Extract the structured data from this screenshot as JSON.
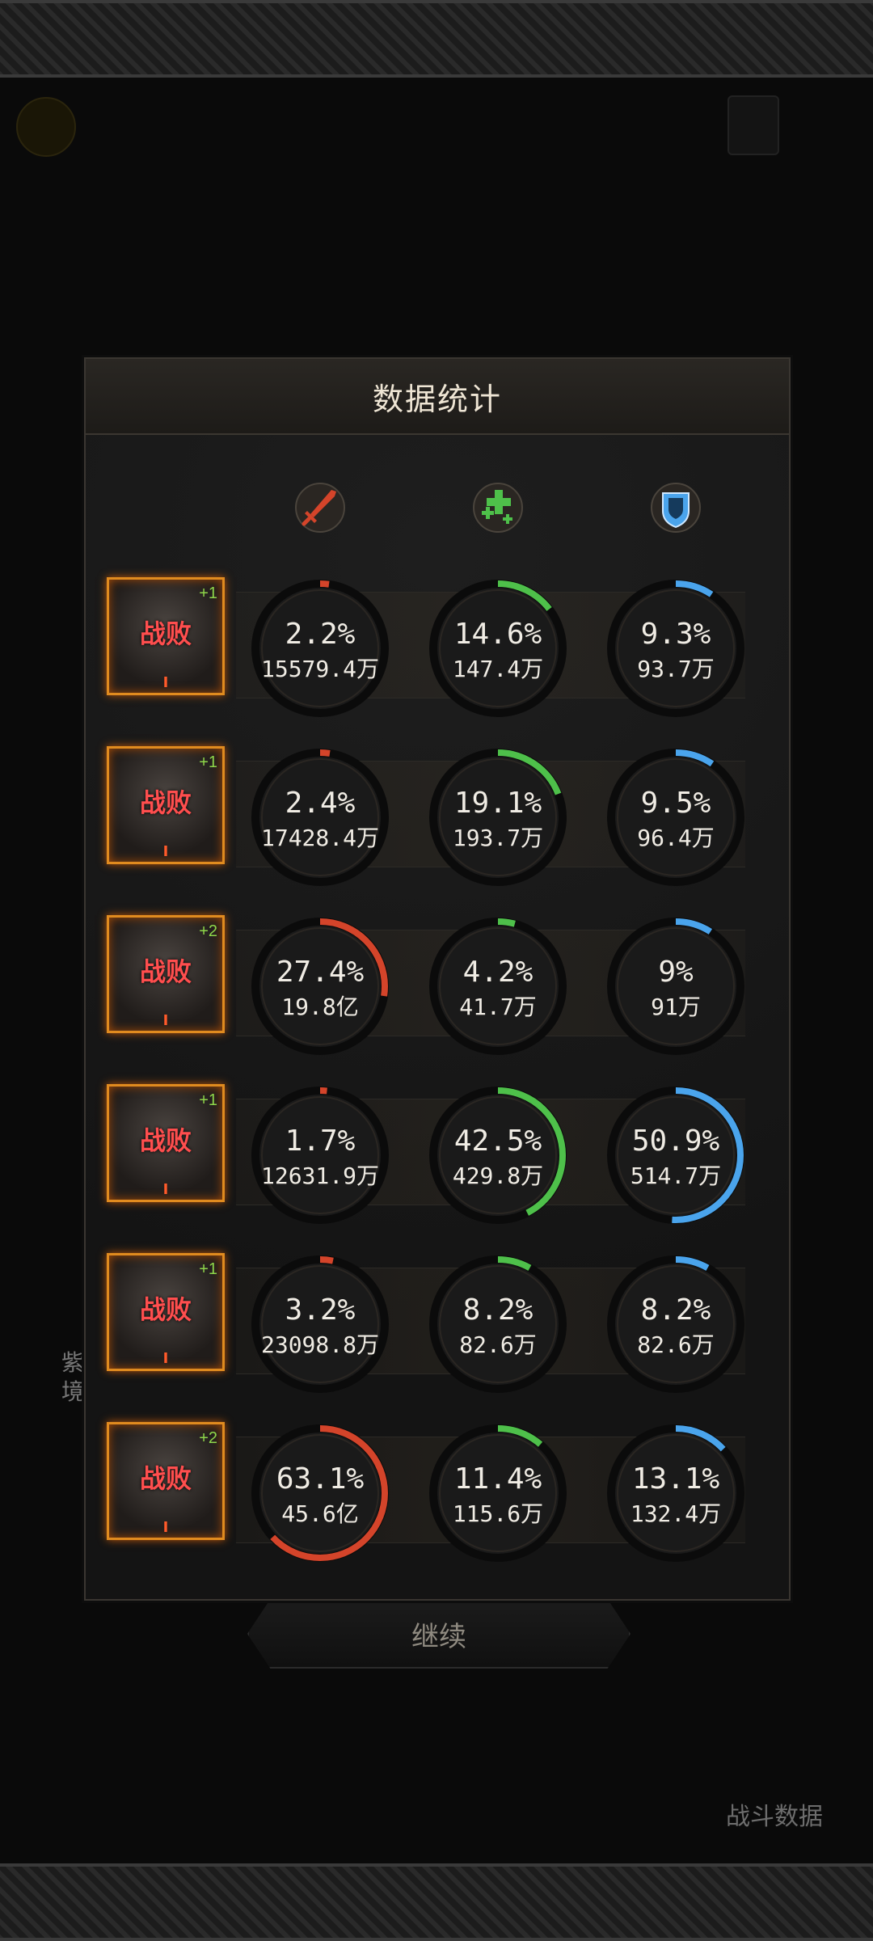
{
  "background": {
    "left_text": "紫\n境",
    "continue_label": "继续",
    "bottom_right_label": "战斗数据"
  },
  "panel": {
    "title": "数据统计",
    "columns": [
      {
        "icon": "sword-icon",
        "color": "#d4442a"
      },
      {
        "icon": "heal-plus-icon",
        "color": "#4ec04a"
      },
      {
        "icon": "shield-icon",
        "color": "#4aa4ec"
      }
    ],
    "rows": [
      {
        "status": "战败",
        "stars": "+1",
        "rank": "I",
        "cells": [
          {
            "percent": 2.2,
            "pct": "2.2%",
            "value": "15579.4万"
          },
          {
            "percent": 14.6,
            "pct": "14.6%",
            "value": "147.4万"
          },
          {
            "percent": 9.3,
            "pct": "9.3%",
            "value": "93.7万"
          }
        ]
      },
      {
        "status": "战败",
        "stars": "+1",
        "rank": "I",
        "cells": [
          {
            "percent": 2.4,
            "pct": "2.4%",
            "value": "17428.4万"
          },
          {
            "percent": 19.1,
            "pct": "19.1%",
            "value": "193.7万"
          },
          {
            "percent": 9.5,
            "pct": "9.5%",
            "value": "96.4万"
          }
        ]
      },
      {
        "status": "战败",
        "stars": "+2",
        "rank": "I",
        "cells": [
          {
            "percent": 27.4,
            "pct": "27.4%",
            "value": "19.8亿"
          },
          {
            "percent": 4.2,
            "pct": "4.2%",
            "value": "41.7万"
          },
          {
            "percent": 9,
            "pct": "9%",
            "value": "91万"
          }
        ]
      },
      {
        "status": "战败",
        "stars": "+1",
        "rank": "I",
        "cells": [
          {
            "percent": 1.7,
            "pct": "1.7%",
            "value": "12631.9万"
          },
          {
            "percent": 42.5,
            "pct": "42.5%",
            "value": "429.8万"
          },
          {
            "percent": 50.9,
            "pct": "50.9%",
            "value": "514.7万"
          }
        ]
      },
      {
        "status": "战败",
        "stars": "+1",
        "rank": "I",
        "cells": [
          {
            "percent": 3.2,
            "pct": "3.2%",
            "value": "23098.8万"
          },
          {
            "percent": 8.2,
            "pct": "8.2%",
            "value": "82.6万"
          },
          {
            "percent": 8.2,
            "pct": "8.2%",
            "value": "82.6万"
          }
        ]
      },
      {
        "status": "战败",
        "stars": "+2",
        "rank": "I",
        "cells": [
          {
            "percent": 63.1,
            "pct": "63.1%",
            "value": "45.6亿"
          },
          {
            "percent": 11.4,
            "pct": "11.4%",
            "value": "115.6万"
          },
          {
            "percent": 13.1,
            "pct": "13.1%",
            "value": "132.4万"
          }
        ]
      }
    ]
  }
}
